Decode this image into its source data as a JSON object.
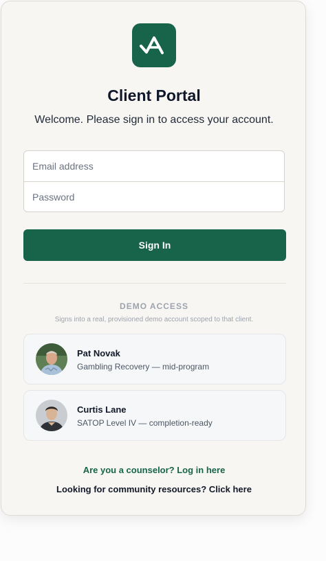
{
  "app": {
    "title": "Client Portal",
    "subtitle": "Welcome. Please sign in to access your account.",
    "logo_icon": "mountain-check-icon",
    "accent_color": "#17644a"
  },
  "form": {
    "email_placeholder": "Email address",
    "email_value": "",
    "password_placeholder": "Password",
    "password_value": "",
    "sign_in_label": "Sign In"
  },
  "demo": {
    "heading": "DEMO ACCESS",
    "description": "Signs into a real, provisioned demo account scoped to that client.",
    "accounts": [
      {
        "name": "Pat Novak",
        "description": "Gambling Recovery — mid-program"
      },
      {
        "name": "Curtis Lane",
        "description": "SATOP Level IV — completion-ready"
      }
    ]
  },
  "links": {
    "counselor": "Are you a counselor? Log in here",
    "community": "Looking for community resources? Click here"
  }
}
